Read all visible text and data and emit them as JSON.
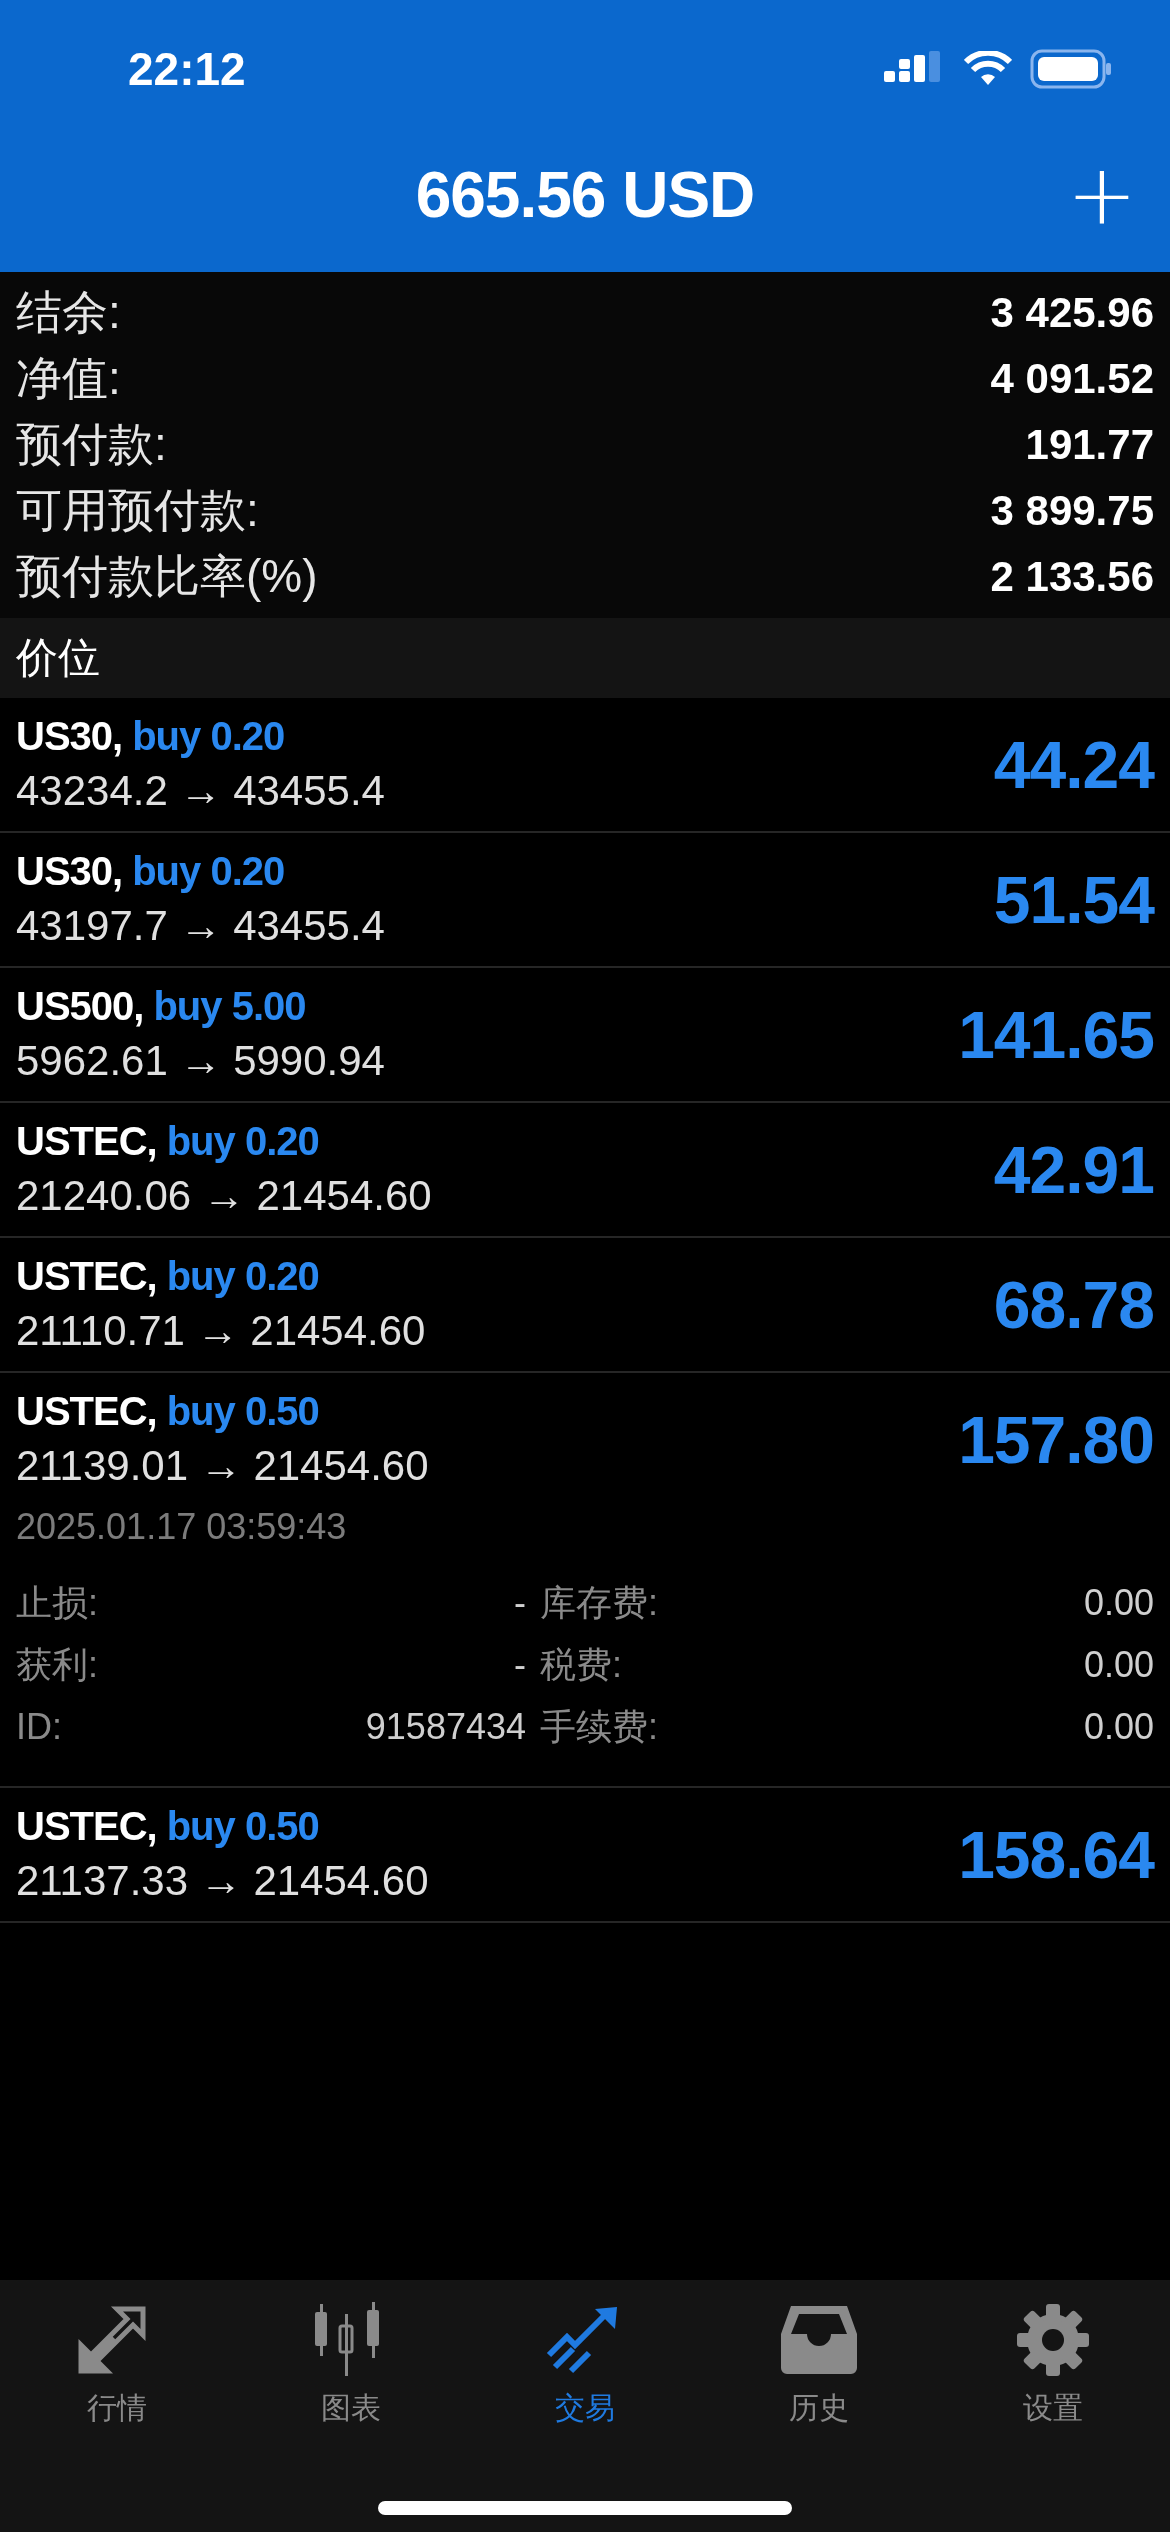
{
  "status_bar": {
    "time": "22:12"
  },
  "header": {
    "title": "665.56 USD",
    "add_button": "+"
  },
  "summary": [
    {
      "label": "结余:",
      "value": "3 425.96"
    },
    {
      "label": "净值:",
      "value": "4 091.52"
    },
    {
      "label": "预付款:",
      "value": "191.77"
    },
    {
      "label": "可用预付款:",
      "value": "3 899.75"
    },
    {
      "label": "预付款比率(%)",
      "value": "2 133.56"
    }
  ],
  "section_title": "价位",
  "positions": [
    {
      "symbol": "US30,",
      "side": "buy 0.20",
      "prices": "43234.2 → 43455.4",
      "profit": "44.24"
    },
    {
      "symbol": "US30,",
      "side": "buy 0.20",
      "prices": "43197.7 → 43455.4",
      "profit": "51.54"
    },
    {
      "symbol": "US500,",
      "side": "buy 5.00",
      "prices": "5962.61 → 5990.94",
      "profit": "141.65"
    },
    {
      "symbol": "USTEC,",
      "side": "buy 0.20",
      "prices": "21240.06 → 21454.60",
      "profit": "42.91"
    },
    {
      "symbol": "USTEC,",
      "side": "buy 0.20",
      "prices": "21110.71 → 21454.60",
      "profit": "68.78"
    },
    {
      "symbol": "USTEC,",
      "side": "buy 0.50",
      "prices": "21139.01 → 21454.60",
      "profit": "157.80",
      "details": {
        "time": "2025.01.17 03:59:43",
        "fields": [
          {
            "left_label": "止损:",
            "left_value": "-",
            "right_label": "库存费:",
            "right_value": "0.00"
          },
          {
            "left_label": "获利:",
            "left_value": "-",
            "right_label": "税费:",
            "right_value": "0.00"
          },
          {
            "left_label": "ID:",
            "left_value": "91587434",
            "right_label": "手续费:",
            "right_value": "0.00"
          }
        ]
      }
    },
    {
      "symbol": "USTEC,",
      "side": "buy 0.50",
      "prices": "21137.33 → 21454.60",
      "profit": "158.64"
    }
  ],
  "tab_bar": [
    {
      "label": "行情",
      "selected": false
    },
    {
      "label": "图表",
      "selected": false
    },
    {
      "label": "交易",
      "selected": true
    },
    {
      "label": "历史",
      "selected": false
    },
    {
      "label": "设置",
      "selected": false
    }
  ]
}
